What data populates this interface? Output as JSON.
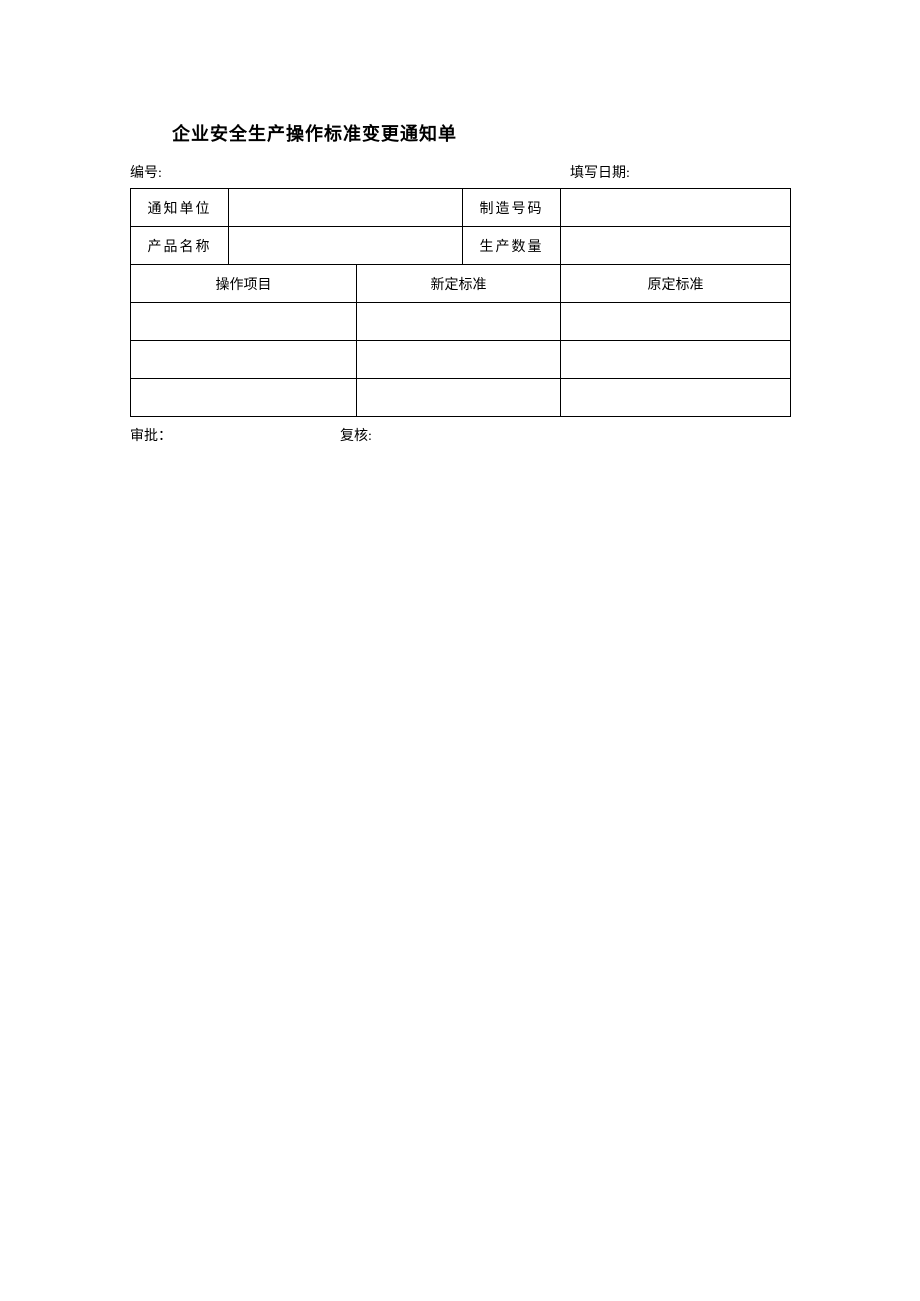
{
  "title": "企业安全生产操作标准变更通知单",
  "meta": {
    "id_label": "编号:",
    "id_value": "",
    "date_label": "填写日期:",
    "date_value": ""
  },
  "table_top": {
    "notify_unit_label": "通知单位",
    "notify_unit_value": "",
    "manufacture_no_label": "制造号码",
    "manufacture_no_value": "",
    "product_name_label": "产品名称",
    "product_name_value": "",
    "production_qty_label": "生产数量",
    "production_qty_value": ""
  },
  "columns": {
    "operation_item": "操作项目",
    "new_standard": "新定标准",
    "original_standard": "原定标准"
  },
  "rows": [
    {
      "operation_item": "",
      "new_standard": "",
      "original_standard": ""
    },
    {
      "operation_item": "",
      "new_standard": "",
      "original_standard": ""
    },
    {
      "operation_item": "",
      "new_standard": "",
      "original_standard": ""
    }
  ],
  "footer": {
    "approve_label": "审批：",
    "approve_value": "",
    "review_label": "复核:",
    "review_value": ""
  }
}
